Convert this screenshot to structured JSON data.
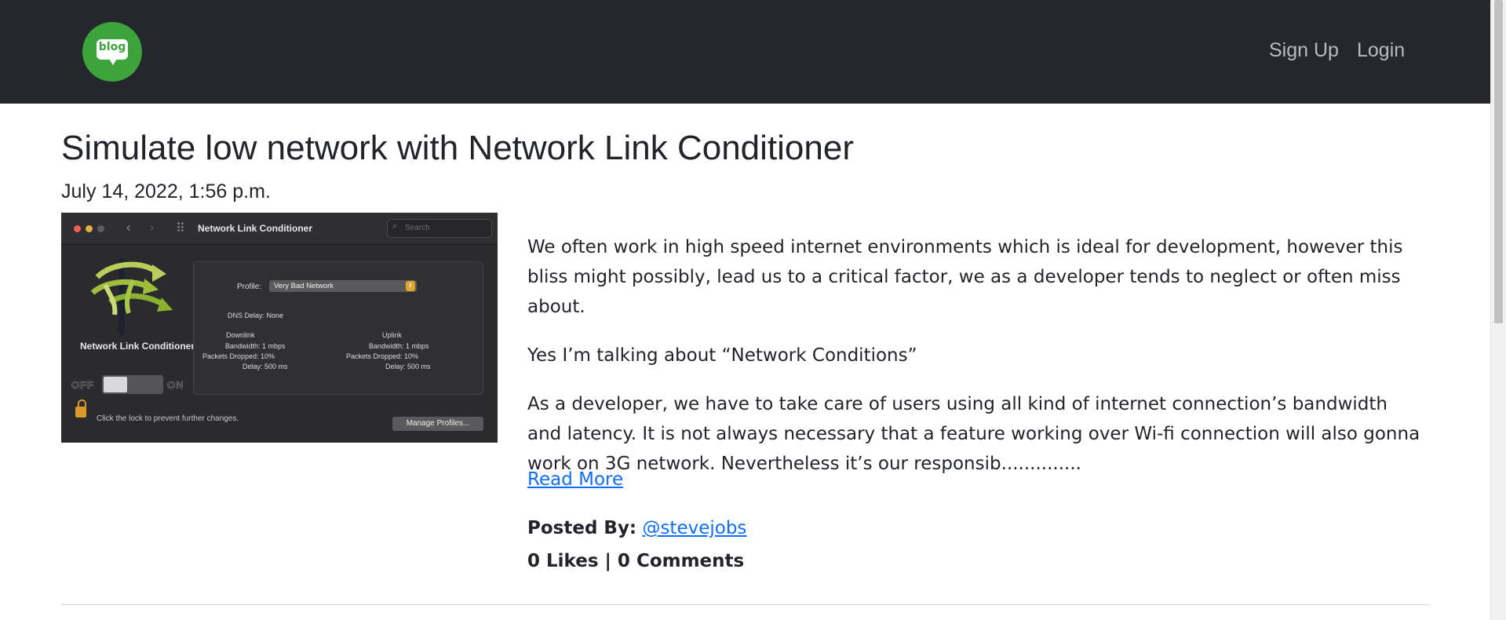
{
  "navbar": {
    "logo_text": "blog",
    "links": {
      "signup": "Sign Up",
      "login": "Login"
    }
  },
  "post": {
    "title": "Simulate low network with Network Link Conditioner",
    "date": "July 14, 2022, 1:56 p.m.",
    "image": {
      "window_title": "Network Link Conditioner",
      "search_placeholder": "Search",
      "app_name": "Network Link Conditioner",
      "switch_off": "OFF",
      "switch_on": "ON",
      "profile_label": "Profile:",
      "profile_value": "Very Bad Network",
      "dns_delay": "DNS Delay: None",
      "downlink": {
        "title": "Downlink",
        "bandwidth": "Bandwidth: 1 mbps",
        "packets": "Packets Dropped: 10%",
        "delay": "Delay: 500 ms"
      },
      "uplink": {
        "title": "Uplink",
        "bandwidth": "Bandwidth: 1 mbps",
        "packets": "Packets Dropped: 10%",
        "delay": "Delay: 500 ms"
      },
      "lock_text": "Click the lock to prevent further changes.",
      "manage_button": "Manage Profiles..."
    },
    "excerpt": [
      "We often work in high speed internet environments which is ideal for development, however this bliss might possibly, lead us to a critical factor, we as a developer tends to neglect or often miss about.",
      "Yes I’m talking about “Network Conditions”",
      "As a developer, we have to take care of users using all kind of internet connection’s bandwidth and latency. It is not always necessary that a feature working over Wi-fi connection will also gonna work on 3G network. Nevertheless it’s our responsib.............."
    ],
    "read_more": "Read More",
    "posted_by_label": "Posted By:",
    "author": "@stevejobs",
    "stats": "0 Likes | 0 Comments"
  },
  "colors": {
    "navbar_bg": "#24272b",
    "logo_green": "#3da33b",
    "link_blue": "#0d6efd"
  }
}
